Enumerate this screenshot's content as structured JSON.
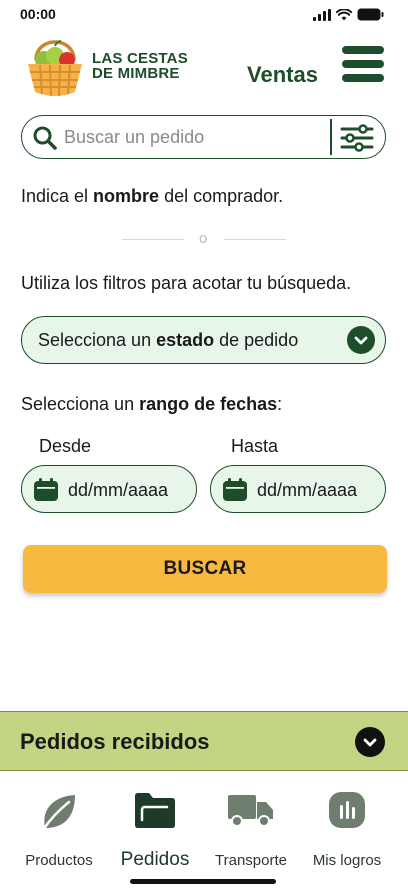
{
  "status_bar": {
    "time": "00:00"
  },
  "header": {
    "logo_line1": "LAS CESTAS",
    "logo_line2": "DE MIMBRE",
    "title": "Ventas"
  },
  "search": {
    "placeholder": "Buscar un pedido"
  },
  "hints": {
    "buyer_prefix": "Indica el ",
    "buyer_bold": "nombre",
    "buyer_suffix": " del comprador.",
    "or": "o",
    "filters": "Utiliza los filtros para acotar tu búsqueda."
  },
  "status_select": {
    "prefix": "Selecciona un ",
    "bold": "estado",
    "suffix": " de pedido"
  },
  "date_range": {
    "prefix": "Selecciona un ",
    "bold": "rango de fechas",
    "suffix": ":",
    "from_label": "Desde",
    "to_label": "Hasta",
    "from_placeholder": "dd/mm/aaaa",
    "to_placeholder": "dd/mm/aaaa"
  },
  "actions": {
    "search_label": "BUSCAR"
  },
  "received": {
    "title": "Pedidos recibidos"
  },
  "nav": {
    "items": [
      {
        "label": "Productos",
        "icon": "leaf-icon",
        "active": false
      },
      {
        "label": "Pedidos",
        "icon": "folder-icon",
        "active": true
      },
      {
        "label": "Transporte",
        "icon": "truck-icon",
        "active": false
      },
      {
        "label": "Mis logros",
        "icon": "bar-chart-icon",
        "active": false
      }
    ]
  },
  "colors": {
    "brand_green": "#1e4d2b",
    "field_bg": "#e8f5e9",
    "button_yellow": "#f8b940",
    "received_bar": "#c3d583",
    "nav_icon_gray": "#6f7d6e"
  }
}
